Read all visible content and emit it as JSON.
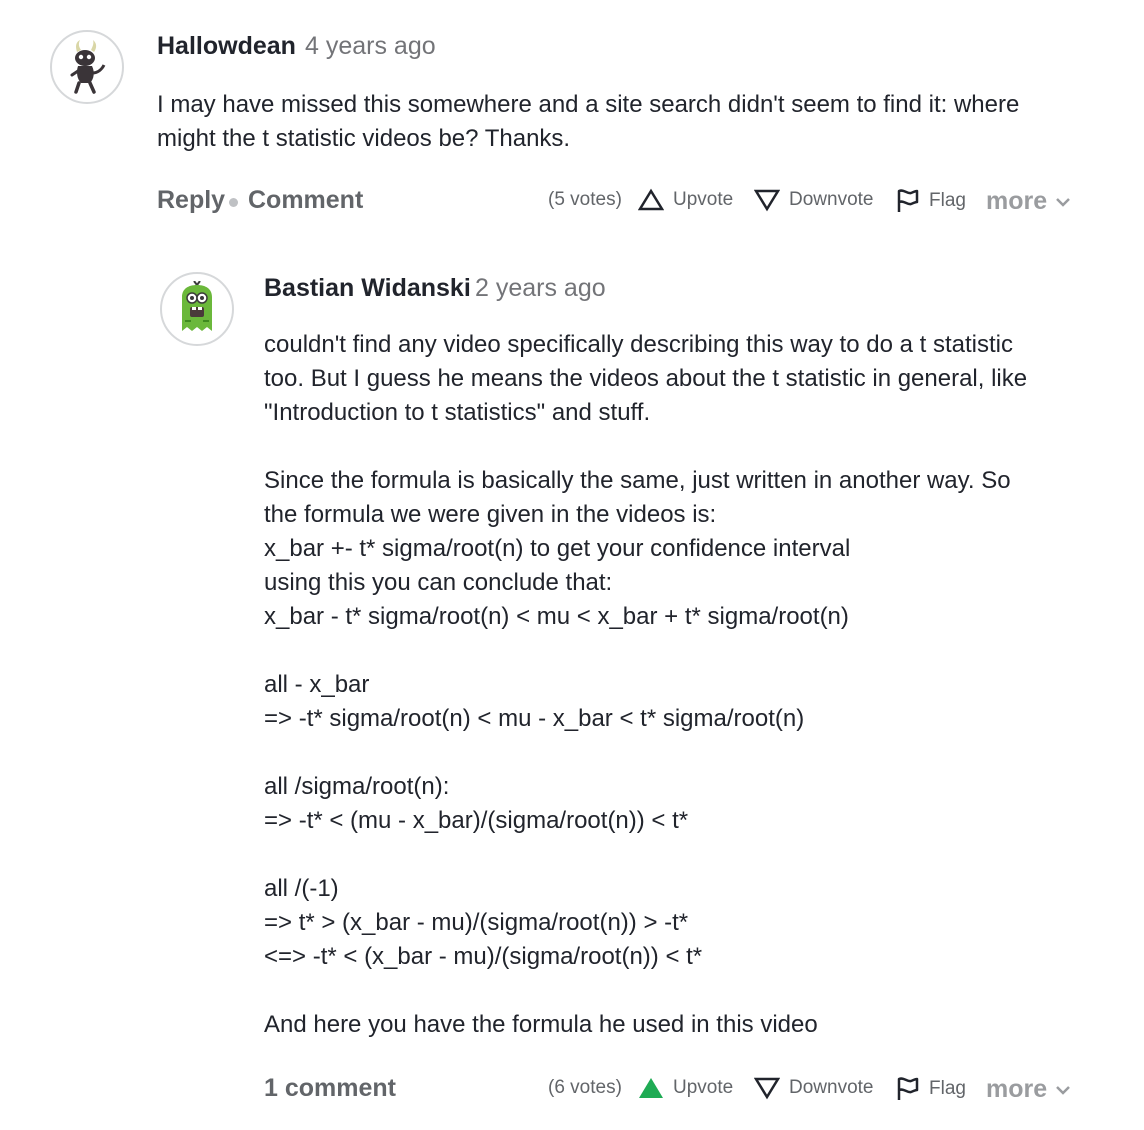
{
  "comment": {
    "author": "Hallowdean",
    "time": "4 years ago",
    "avatar": "horned-creature-avatar",
    "text": "I may have missed this somewhere and a site search didn't seem to find it: where\nmight the t statistic videos be? Thanks.",
    "actions": {
      "reply": "Reply",
      "comment": "Comment",
      "votes": "(5 votes)",
      "upvote": "Upvote",
      "downvote": "Downvote",
      "flag": "Flag",
      "more": "more"
    },
    "upvoted": false
  },
  "reply": {
    "author": "Bastian Widanski",
    "time": "2 years ago",
    "avatar": "green-monster-avatar",
    "text": "couldn't find any video specifically describing this way to do a t statistic\ntoo. But I guess he means the videos about the t statistic in general, like\n\"Introduction to t statistics\" and stuff.\n\nSince the formula is basically the same, just written in another way. So\nthe formula we were given in the videos is:\nx_bar +- t* sigma/root(n) to get your confidence interval\nusing this you can conclude that:\nx_bar - t* sigma/root(n) < mu < x_bar + t* sigma/root(n)\n\nall - x_bar\n=> -t* sigma/root(n) < mu - x_bar < t* sigma/root(n)\n\nall /sigma/root(n):\n=> -t* < (mu - x_bar)/(sigma/root(n)) < t*\n\nall /(-1)\n=> t* > (x_bar - mu)/(sigma/root(n)) > -t*\n<=> -t* < (x_bar - mu)/(sigma/root(n)) < t*\n\nAnd here you have the formula he used in this video",
    "actions": {
      "comments": "1 comment",
      "votes": "(6 votes)",
      "upvote": "Upvote",
      "downvote": "Downvote",
      "flag": "Flag",
      "more": "more"
    },
    "upvoted": true
  },
  "colors": {
    "upvote_active": "#1fab54",
    "text": "#21242c",
    "muted": "#626569"
  }
}
